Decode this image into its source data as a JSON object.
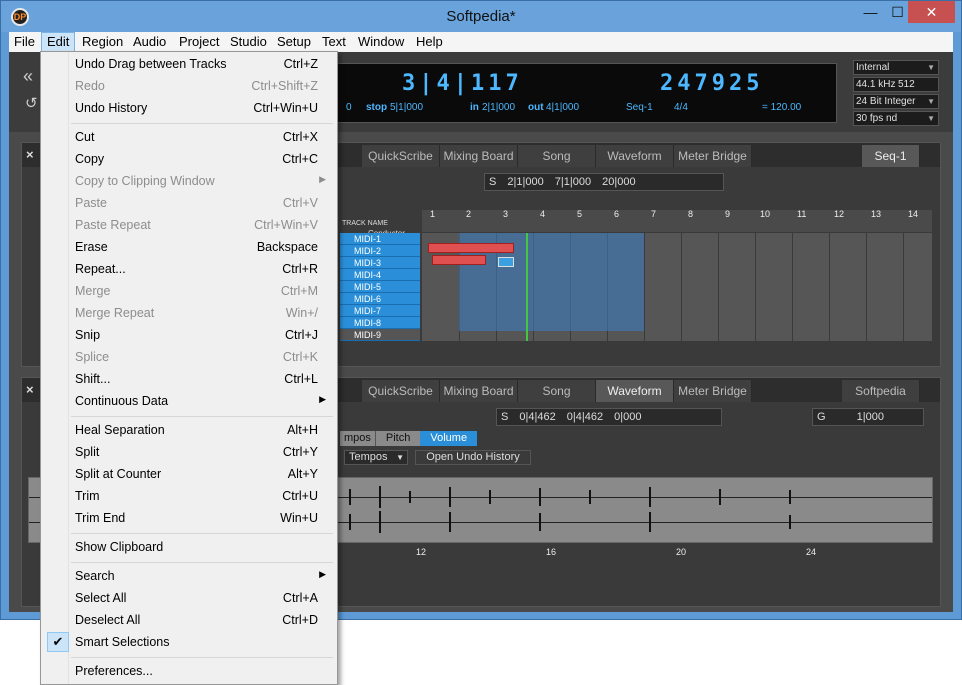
{
  "window": {
    "title": "Softpedia*",
    "min_glyph": "—",
    "max_glyph": "☐",
    "close_glyph": "✕"
  },
  "menubar": [
    "File",
    "Edit",
    "Region",
    "Audio",
    "Project",
    "Studio",
    "Setup",
    "Text",
    "Window",
    "Help"
  ],
  "transport": {
    "meter": "3|4|117",
    "counter": "247925",
    "stop_label": "stop",
    "stop_value": "5|1|000",
    "in_label": "in",
    "in_value": "2|1|000",
    "out_label": "out",
    "out_value": "4|1|000",
    "seq_label": "Seq-1",
    "time_sig": "4/4",
    "tempo": "= 120.00",
    "left_value": "0"
  },
  "setup_box": {
    "sync": "Internal",
    "rate": "44.1 kHz",
    "buffer": "512",
    "format": "24 Bit Integer",
    "fps": "30 fps nd"
  },
  "panel1": {
    "tabs": [
      "QuickScribe",
      "Mixing Board",
      "Song",
      "Waveform",
      "Meter Bridge"
    ],
    "selected_tab": "Seq-1",
    "toolbar": {
      "s": "S",
      "a": "2|1|000",
      "b": "7|1|000",
      "c": "20|000"
    },
    "track_header": "TRACK NAME",
    "conductor": "Conductor",
    "tracks": [
      "MIDI-1",
      "MIDI-2",
      "MIDI-3",
      "MIDI-4",
      "MIDI-5",
      "MIDI-6",
      "MIDI-7",
      "MIDI-8",
      "MIDI-9"
    ],
    "ruler": [
      "1",
      "2",
      "3",
      "4",
      "5",
      "6",
      "7",
      "8",
      "9",
      "10",
      "11",
      "12",
      "13",
      "14"
    ]
  },
  "panel2": {
    "tabs": [
      "QuickScribe",
      "Mixing Board",
      "Song",
      "Waveform",
      "Meter Bridge"
    ],
    "selected_tab": "Softpedia",
    "toolbar": {
      "s": "S",
      "a": "0|4|462",
      "b": "0|4|462",
      "c": "0|000"
    },
    "right_tool": {
      "g": "G",
      "value": "1|000"
    },
    "subtabs": [
      "mpos",
      "Pitch",
      "Volume"
    ],
    "tempos_select": "Tempos",
    "undo_button": "Open Undo History",
    "ruler": [
      "12",
      "16",
      "20",
      "24"
    ]
  },
  "edit_menu": {
    "items": [
      {
        "label": "Undo Drag between Tracks",
        "shortcut": "Ctrl+Z",
        "enabled": true
      },
      {
        "label": "Redo",
        "shortcut": "Ctrl+Shift+Z",
        "enabled": false
      },
      {
        "label": "Undo History",
        "shortcut": "Ctrl+Win+U",
        "enabled": true
      },
      {
        "label": "Cut",
        "shortcut": "Ctrl+X",
        "enabled": true
      },
      {
        "label": "Copy",
        "shortcut": "Ctrl+C",
        "enabled": true
      },
      {
        "label": "Copy to Clipping Window",
        "shortcut": "",
        "enabled": false,
        "submenu": true
      },
      {
        "label": "Paste",
        "shortcut": "Ctrl+V",
        "enabled": false
      },
      {
        "label": "Paste Repeat",
        "shortcut": "Ctrl+Win+V",
        "enabled": false
      },
      {
        "label": "Erase",
        "shortcut": "Backspace",
        "enabled": true
      },
      {
        "label": "Repeat...",
        "shortcut": "Ctrl+R",
        "enabled": true
      },
      {
        "label": "Merge",
        "shortcut": "Ctrl+M",
        "enabled": false
      },
      {
        "label": "Merge Repeat",
        "shortcut": "Win+/",
        "enabled": false
      },
      {
        "label": "Snip",
        "shortcut": "Ctrl+J",
        "enabled": true
      },
      {
        "label": "Splice",
        "shortcut": "Ctrl+K",
        "enabled": false
      },
      {
        "label": "Shift...",
        "shortcut": "Ctrl+L",
        "enabled": true
      },
      {
        "label": "Continuous Data",
        "shortcut": "",
        "enabled": true,
        "submenu": true
      },
      {
        "label": "Heal Separation",
        "shortcut": "Alt+H",
        "enabled": true
      },
      {
        "label": "Split",
        "shortcut": "Ctrl+Y",
        "enabled": true
      },
      {
        "label": "Split at Counter",
        "shortcut": "Alt+Y",
        "enabled": true
      },
      {
        "label": "Trim",
        "shortcut": "Ctrl+U",
        "enabled": true
      },
      {
        "label": "Trim End",
        "shortcut": "Win+U",
        "enabled": true
      },
      {
        "label": "Show Clipboard",
        "shortcut": "",
        "enabled": true
      },
      {
        "label": "Search",
        "shortcut": "",
        "enabled": true,
        "submenu": true
      },
      {
        "label": "Select All",
        "shortcut": "Ctrl+A",
        "enabled": true
      },
      {
        "label": "Deselect All",
        "shortcut": "Ctrl+D",
        "enabled": true
      },
      {
        "label": "Smart Selections",
        "shortcut": "",
        "enabled": true,
        "checked": true
      },
      {
        "label": "Preferences...",
        "shortcut": "",
        "enabled": true
      }
    ]
  },
  "colors": {
    "accent": "#4db8ff",
    "track": "#2a8fd8",
    "titlebar": "#6aa3dc"
  }
}
